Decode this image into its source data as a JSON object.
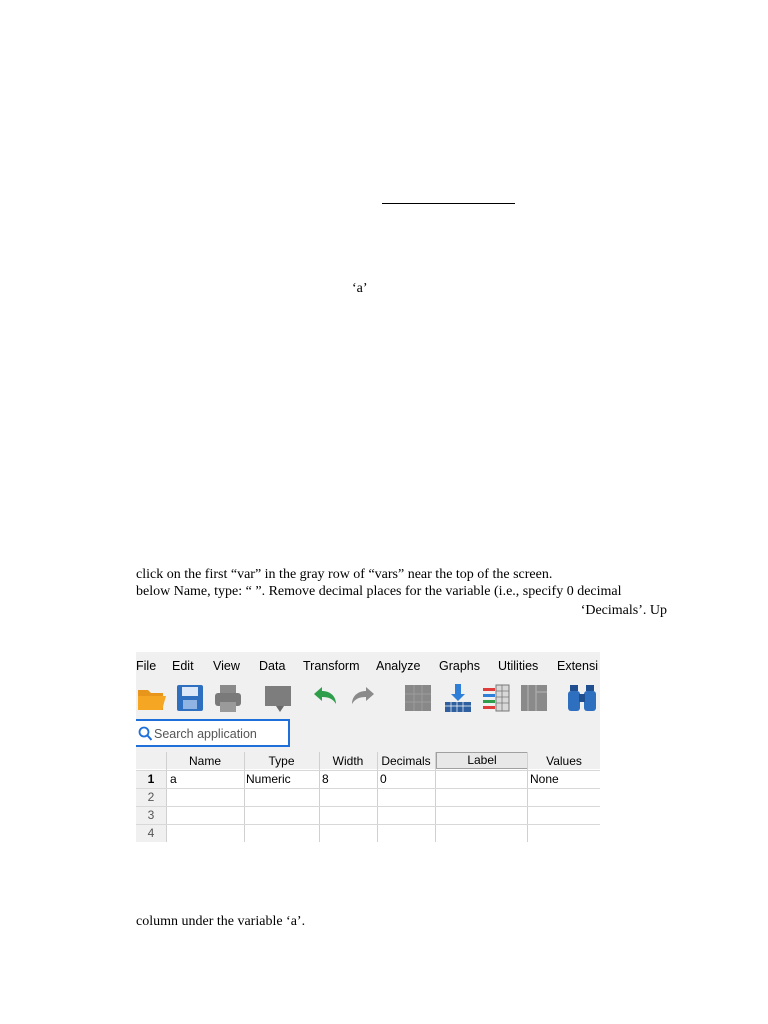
{
  "top_line": "",
  "quote_a": "‘a’",
  "instructions": {
    "line1": "click on the first “var” in the gray row of “vars” near the top of the screen.",
    "line2": "below Name, type: “  ”. Remove decimal places for the variable (i.e., specify 0 decimal",
    "line3": "‘Decimals’. Up",
    "line4": "column under the variable ‘a’."
  },
  "app": {
    "menu": [
      "File",
      "Edit",
      "View",
      "Data",
      "Transform",
      "Analyze",
      "Graphs",
      "Utilities",
      "Extensi"
    ],
    "toolbar_icons": [
      "open-folder-icon",
      "save-icon",
      "print-icon",
      "dialog-recall-icon",
      "undo-icon",
      "redo-icon",
      "goto-case-icon",
      "goto-variable-icon",
      "variables-icon",
      "run-descriptives-icon",
      "find-icon"
    ],
    "search": {
      "placeholder": "Search application"
    },
    "columns": [
      "Name",
      "Type",
      "Width",
      "Decimals",
      "Label",
      "Values"
    ],
    "rows": [
      {
        "num": "1",
        "name": "a",
        "type": "Numeric",
        "width": "8",
        "decimals": "0",
        "label": "",
        "values": "None"
      },
      {
        "num": "2",
        "name": "",
        "type": "",
        "width": "",
        "decimals": "",
        "label": "",
        "values": ""
      },
      {
        "num": "3",
        "name": "",
        "type": "",
        "width": "",
        "decimals": "",
        "label": "",
        "values": ""
      },
      {
        "num": "4",
        "name": "",
        "type": "",
        "width": "",
        "decimals": "",
        "label": "",
        "values": ""
      }
    ],
    "colors": {
      "accent": "#1e6fd9",
      "folder": "#f5a623",
      "undo": "#2e9e4a"
    }
  }
}
